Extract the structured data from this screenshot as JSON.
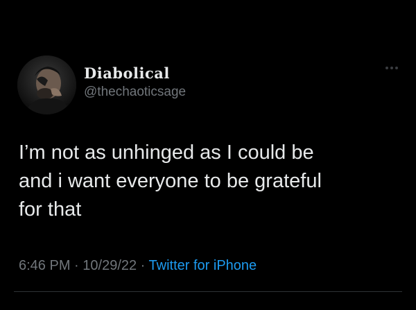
{
  "author": {
    "display_name": "Diabolical",
    "handle": "@thechaoticsage",
    "avatar_icon": "profile-photo-avatar"
  },
  "more_icon": "ellipsis-icon",
  "tweet": {
    "line1": "I’m not as unhinged as I could be",
    "line2": "and i want everyone to be grateful",
    "line3": "for that"
  },
  "meta": {
    "time": "6:46 PM",
    "separator": " · ",
    "date": "10/29/22",
    "separator2": " · ",
    "source": "Twitter for iPhone"
  },
  "colors": {
    "background": "#000000",
    "text": "#e7e9ea",
    "secondary": "#71767b",
    "link": "#1d9bf0"
  }
}
